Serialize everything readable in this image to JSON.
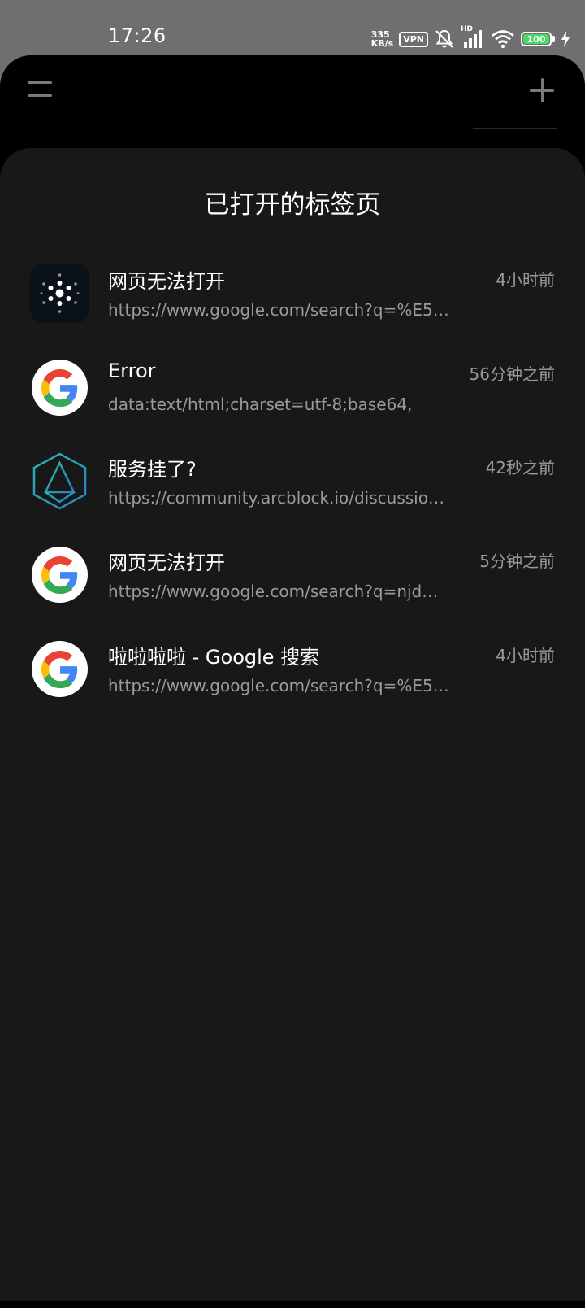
{
  "status_bar": {
    "time": "17:26",
    "net_speed_value": "335",
    "net_speed_unit": "KB/s",
    "vpn": "VPN",
    "signal_label": "HD",
    "battery": "100",
    "battery_level": 1.0,
    "icons": [
      "vpn-icon",
      "mute-icon",
      "signal-icon",
      "wifi-icon",
      "battery-icon",
      "charging-icon"
    ]
  },
  "browser": {
    "menu_icon": "menu-icon",
    "add_icon": "plus-icon"
  },
  "sheet": {
    "title": "已打开的标签页"
  },
  "tabs": [
    {
      "title": "网页无法打开",
      "url": "https://www.google.com/search?q=%E5…",
      "time": "4小时前",
      "icon": "arcblock-dots-icon"
    },
    {
      "title": "Error",
      "url": "data:text/html;charset=utf-8;base64,",
      "time": "56分钟之前",
      "icon": "google-icon"
    },
    {
      "title": "服务挂了?",
      "url": "https://community.arcblock.io/discussio…",
      "time": "42秒之前",
      "icon": "arcblock-cube-icon"
    },
    {
      "title": "网页无法打开",
      "url": "https://www.google.com/search?q=njd…",
      "time": "5分钟之前",
      "icon": "google-icon"
    },
    {
      "title": "啦啦啦啦 - Google 搜索",
      "url": "https://www.google.com/search?q=%E5…",
      "time": "4小时前",
      "icon": "google-icon"
    }
  ],
  "colors": {
    "google_blue": "#4285F4",
    "google_red": "#EA4335",
    "google_yellow": "#FBBC05",
    "google_green": "#34A853",
    "battery_green": "#4cd964"
  }
}
